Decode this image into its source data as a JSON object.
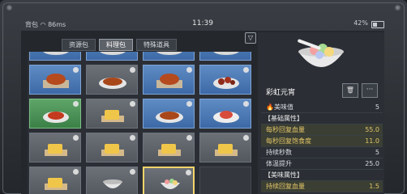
{
  "status": {
    "carrier": "背包",
    "network": "86ms",
    "time": "11:39",
    "battery": "42%",
    "battery_level": 0.42
  },
  "tabs": [
    {
      "label": "资源包"
    },
    {
      "label": "料理包",
      "active": true
    },
    {
      "label": "特殊道具"
    }
  ],
  "sort_icon": "sort-icon",
  "detail": {
    "title": "彩虹元宵",
    "trash_icon": "trash-icon",
    "more_label": "···",
    "rows": [
      {
        "k": "🔥美味值",
        "v": "5"
      },
      {
        "k": "【基础属性】",
        "v": "",
        "header": true
      },
      {
        "k": "每秒回复血量",
        "v": "55.0",
        "hi": true
      },
      {
        "k": "每秒回复饱食度",
        "v": "11.0",
        "hi": true
      },
      {
        "k": "持续秒数",
        "v": "5"
      },
      {
        "k": "体温提升",
        "v": "25.0"
      },
      {
        "k": "【美味属性】",
        "v": "",
        "header": true
      },
      {
        "k": "持续回复血量",
        "v": "1.5",
        "hi": true
      }
    ]
  }
}
